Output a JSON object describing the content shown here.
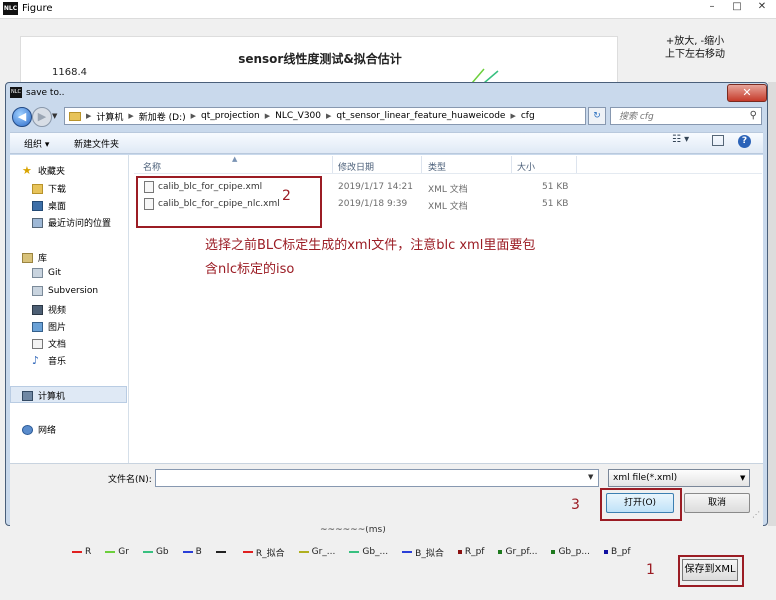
{
  "figure_window": {
    "title": "Figure",
    "app_icon": "NLC",
    "plot_title": "sensor线性度测试&拟合估计",
    "y_tick": "1168.4",
    "hint_line1": "+放大, -缩小",
    "hint_line2": "上下左右移动",
    "x_axis_partial": "~~~~~~(ms)",
    "legend": [
      {
        "label": "R",
        "color": "#e02020",
        "style": "solid"
      },
      {
        "label": "Gr",
        "color": "#6ccf3c",
        "style": "solid"
      },
      {
        "label": "Gb",
        "color": "#38c080",
        "style": "solid"
      },
      {
        "label": "B",
        "color": "#2a3fd8",
        "style": "solid"
      },
      {
        "label": "",
        "color": "#222222",
        "style": "solid"
      },
      {
        "label": "R_拟合",
        "color": "#e02020",
        "style": "dash"
      },
      {
        "label": "Gr_...",
        "color": "#b0b020",
        "style": "dash"
      },
      {
        "label": "Gb_...",
        "color": "#38c080",
        "style": "dash"
      },
      {
        "label": "B_拟合",
        "color": "#2a3fd8",
        "style": "dash"
      },
      {
        "label": "R_pf",
        "color": "#8b1010",
        "style": "dot"
      },
      {
        "label": "Gr_pf...",
        "color": "#1e7a1e",
        "style": "dot"
      },
      {
        "label": "Gb_p...",
        "color": "#1e7a1e",
        "style": "dot"
      },
      {
        "label": "B_pf",
        "color": "#1010a0",
        "style": "dot"
      }
    ],
    "save_button": "保存到XML"
  },
  "dialog": {
    "title": "save to..",
    "breadcrumb": [
      "计算机",
      "新加卷 (D:)",
      "qt_projection",
      "NLC_V300",
      "qt_sensor_linear_feature_huaweicode",
      "cfg"
    ],
    "search_placeholder": "搜索 cfg",
    "toolbar": {
      "organize": "组织 ▾",
      "new_folder": "新建文件夹"
    },
    "nav": {
      "favorites": "收藏夹",
      "downloads": "下载",
      "desktop": "桌面",
      "recent": "最近访问的位置",
      "libraries": "库",
      "git": "Git",
      "subversion": "Subversion",
      "videos": "视频",
      "pictures": "图片",
      "documents": "文档",
      "music": "音乐",
      "computer": "计算机",
      "network": "网络"
    },
    "columns": {
      "name": "名称",
      "date": "修改日期",
      "type": "类型",
      "size": "大小"
    },
    "files": [
      {
        "name": "calib_blc_for_cpipe.xml",
        "date": "2019/1/17 14:21",
        "type": "XML 文档",
        "size": "51 KB"
      },
      {
        "name": "calib_blc_for_cpipe_nlc.xml",
        "date": "2019/1/18 9:39",
        "type": "XML 文档",
        "size": "51 KB"
      }
    ],
    "filename_label": "文件名(N):",
    "filename_value": "",
    "filter": "xml file(*.xml)",
    "open_button": "打开(O)",
    "cancel_button": "取消"
  },
  "annotations": {
    "step1": "1",
    "step2": "2",
    "step3": "3",
    "note_line1": "选择之前BLC标定生成的xml文件，注意blc xml里面要包",
    "note_line2": "含nlc标定的iso",
    "accent_color": "#9b1c24"
  }
}
